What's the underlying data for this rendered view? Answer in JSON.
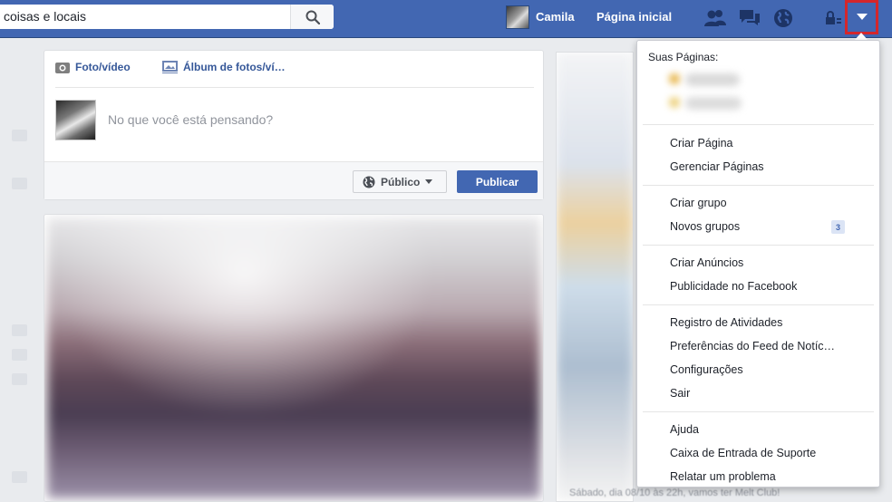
{
  "search": {
    "value": "coisas e locais"
  },
  "header": {
    "profile_name": "Camila",
    "home_label": "Página inicial"
  },
  "composer": {
    "tab_photo_video": "Foto/vídeo",
    "tab_album": "Álbum de fotos/ví…",
    "placeholder": "No que você está pensando?",
    "audience_label": "Público",
    "publish_label": "Publicar"
  },
  "menu": {
    "header": "Suas Páginas:",
    "groups": [
      [
        "Criar Página",
        "Gerenciar Páginas"
      ],
      [
        "Criar grupo",
        "Novos grupos"
      ],
      [
        "Criar Anúncios",
        "Publicidade no Facebook"
      ],
      [
        "Registro de Atividades",
        "Preferências do Feed de Notíc…",
        "Configurações",
        "Sair"
      ],
      [
        "Ajuda",
        "Caixa de Entrada de Suporte",
        "Relatar um problema"
      ]
    ],
    "new_groups_badge": "3"
  },
  "right_column": {
    "footer_text": "Sábado, dia 08/10 às 22h, vamos ter Melt Club!"
  },
  "icons": {
    "search": "search-icon",
    "friends": "friend-requests-icon",
    "messages": "messages-icon",
    "notifications": "globe-notifications-icon",
    "privacy": "privacy-lock-icon",
    "account_menu": "chevron-down-icon"
  },
  "colors": {
    "brand": "#4267b2",
    "highlight_box": "#d4262b"
  }
}
